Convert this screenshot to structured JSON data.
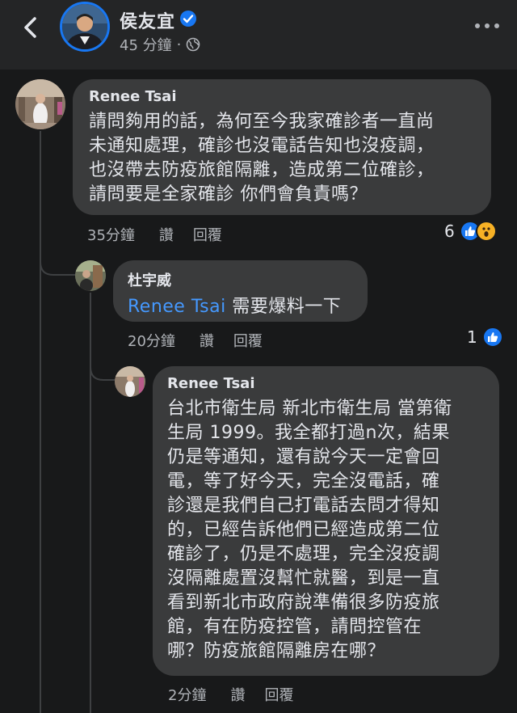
{
  "header": {
    "author_name": "侯友宜",
    "post_time": "45 分鐘",
    "meta_separator": "·"
  },
  "comments": [
    {
      "name": "Renee Tsai",
      "lines": [
        "請問夠用的話，為何至今我家確診者一直尚",
        "未通知處理，確診也沒電話告知也沒疫調，",
        "也沒帶去防疫旅館隔離，造成第二位確診，",
        "請問要是全家確診 你們會負責嗎？"
      ],
      "time": "35分鐘",
      "like_label": "讚",
      "reply_label": "回覆",
      "reaction_count": "6",
      "reaction_icons": [
        "like-icon",
        "wow-icon"
      ]
    },
    {
      "name": "杜宇威",
      "mention": "Renee Tsai",
      "text": " 需要爆料一下",
      "time": "20分鐘",
      "like_label": "讚",
      "reply_label": "回覆",
      "reaction_count": "1",
      "reaction_icons": [
        "like-icon"
      ]
    },
    {
      "name": "Renee Tsai",
      "lines": [
        "台北市衛生局 新北市衛生局 當第衛",
        "生局 1999。我全都打過n次，結果",
        "仍是等通知，還有說今天一定會回",
        "電，等了好今天，完全沒電話，確",
        "診還是我們自己打電話去問才得知",
        "的，已經告訴他們已經造成第二位",
        "確診了，仍是不處理，完全沒疫調",
        "沒隔離處置沒幫忙就醫，到是一直",
        "看到新北市政府說準備很多防疫旅",
        "館，有在防疫控管，請問控管在",
        "哪？防疫旅館隔離房在哪？"
      ],
      "time": "2分鐘",
      "like_label": "讚",
      "reply_label": "回覆"
    }
  ],
  "colors": {
    "background": "#18191a",
    "bubble": "#3a3b3c",
    "mention": "#4599ff",
    "verified": "#1877f2",
    "secondary_text": "#b0b3b8"
  }
}
